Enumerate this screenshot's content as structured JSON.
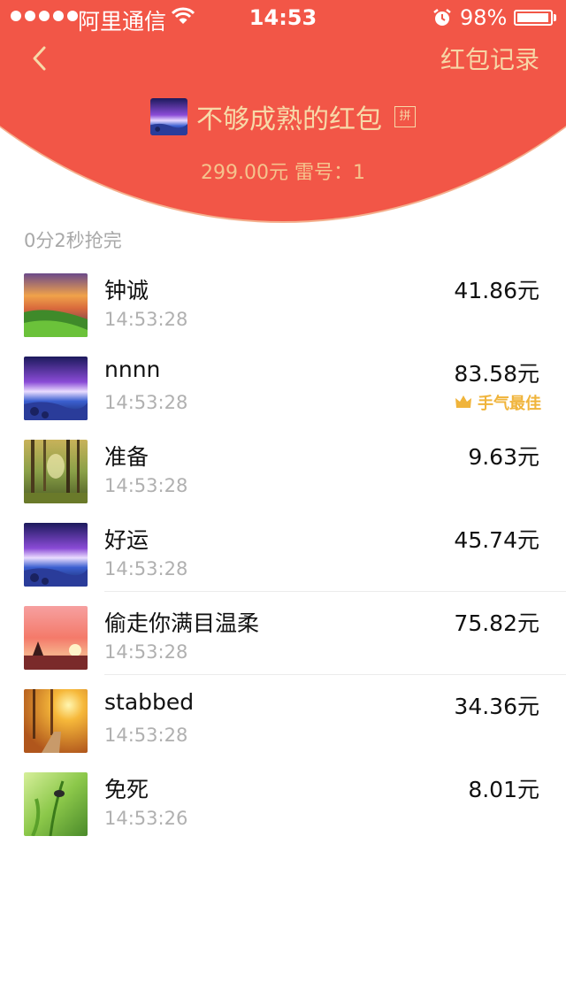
{
  "status_bar": {
    "carrier": "阿里通信",
    "time": "14:53",
    "battery_percent": "98%",
    "battery_level": 0.98
  },
  "nav": {
    "records_label": "红包记录"
  },
  "packet": {
    "title": "不够成熟的红包",
    "badge": "拼",
    "amount_info": "299.00元 雷号：1"
  },
  "summary": "0分2秒抢完",
  "list": [
    {
      "name": "钟诚",
      "time": "14:53:28",
      "amount": "41.86元",
      "avatar": "sunset-landscape"
    },
    {
      "name": "nnnn",
      "time": "14:53:28",
      "amount": "83.58元",
      "avatar": "purple-seascape",
      "badge": "手气最佳"
    },
    {
      "name": "准备",
      "time": "14:53:28",
      "amount": "9.63元",
      "avatar": "forest"
    },
    {
      "name": "好运",
      "time": "14:53:28",
      "amount": "45.74元",
      "avatar": "purple-seascape"
    },
    {
      "name": "偷走你满目温柔",
      "time": "14:53:28",
      "amount": "75.82元",
      "avatar": "pink-sunset"
    },
    {
      "name": "stabbed",
      "time": "14:53:28",
      "amount": "34.36元",
      "avatar": "autumn-road"
    },
    {
      "name": "免死",
      "time": "14:53:26",
      "amount": "8.01元",
      "avatar": "green-plant"
    }
  ],
  "colors": {
    "header_red": "#f25647",
    "gold_text": "#f7d9a8",
    "best_luck": "#f0b43b"
  }
}
